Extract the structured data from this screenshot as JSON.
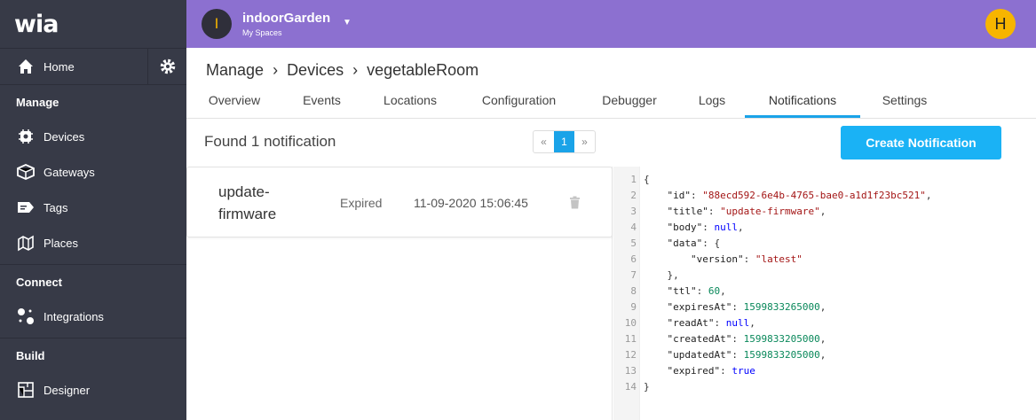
{
  "app": {
    "logo": "wia"
  },
  "sidebar": {
    "home": "Home",
    "sections": [
      {
        "title": "Manage",
        "items": [
          "Devices",
          "Gateways",
          "Tags",
          "Places"
        ]
      },
      {
        "title": "Connect",
        "items": [
          "Integrations"
        ]
      },
      {
        "title": "Build",
        "items": [
          "Designer"
        ]
      }
    ]
  },
  "topbar": {
    "space_initial": "I",
    "space_name": "indoorGarden",
    "space_sub": "My Spaces",
    "user_initial": "H"
  },
  "breadcrumb": [
    "Manage",
    "Devices",
    "vegetableRoom"
  ],
  "tabs": [
    "Overview",
    "Events",
    "Locations",
    "Configuration",
    "Debugger",
    "Logs",
    "Notifications",
    "Settings"
  ],
  "active_tab": "Notifications",
  "found_text": "Found 1 notification",
  "pager": {
    "prev": "«",
    "current": "1",
    "next": "»"
  },
  "create_button": "Create Notification",
  "notification": {
    "name": "update-firmware",
    "status": "Expired",
    "date": "11-09-2020 15:06:45"
  },
  "json_lines": [
    "{",
    "    \"id\": \"88ecd592-6e4b-4765-bae0-a1d1f23bc521\",",
    "    \"title\": \"update-firmware\",",
    "    \"body\": null,",
    "    \"data\": {",
    "        \"version\": \"latest\"",
    "    },",
    "    \"ttl\": 60,",
    "    \"expiresAt\": 1599833265000,",
    "    \"readAt\": null,",
    "    \"createdAt\": 1599833205000,",
    "    \"updatedAt\": 1599833205000,",
    "    \"expired\": true",
    "}"
  ],
  "colors": {
    "sidebar": "#373a47",
    "topbar": "#8c70d0",
    "accent": "#1ab2f5",
    "avatar": "#f7b500"
  }
}
